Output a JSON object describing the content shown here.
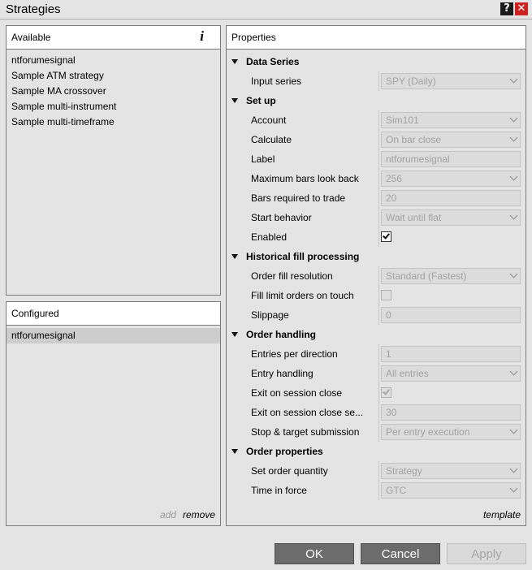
{
  "window": {
    "title": "Strategies",
    "help_glyph": "?",
    "close_glyph": "✕"
  },
  "available": {
    "header": "Available",
    "info_glyph": "i",
    "items": [
      "ntforumesignal",
      "Sample ATM strategy",
      "Sample MA crossover",
      "Sample multi-instrument",
      "Sample multi-timeframe"
    ]
  },
  "configured": {
    "header": "Configured",
    "items": [
      "ntforumesignal"
    ],
    "add_label": "add",
    "remove_label": "remove"
  },
  "properties": {
    "header": "Properties",
    "template_label": "template",
    "sections": {
      "data_series": {
        "label": "Data Series",
        "input_series_label": "Input series",
        "input_series_value": "SPY (Daily)"
      },
      "setup": {
        "label": "Set up",
        "account_label": "Account",
        "account_value": "Sim101",
        "calculate_label": "Calculate",
        "calculate_value": "On bar close",
        "label_label": "Label",
        "label_value": "ntforumesignal",
        "max_bars_label": "Maximum bars look back",
        "max_bars_value": "256",
        "bars_required_label": "Bars required to trade",
        "bars_required_value": "20",
        "start_behavior_label": "Start behavior",
        "start_behavior_value": "Wait until flat",
        "enabled_label": "Enabled",
        "enabled_value": true
      },
      "historical": {
        "label": "Historical fill processing",
        "order_fill_label": "Order fill resolution",
        "order_fill_value": "Standard (Fastest)",
        "fill_limit_label": "Fill limit orders on touch",
        "fill_limit_value": false,
        "slippage_label": "Slippage",
        "slippage_value": "0"
      },
      "order_handling": {
        "label": "Order handling",
        "entries_label": "Entries per direction",
        "entries_value": "1",
        "entry_handling_label": "Entry handling",
        "entry_handling_value": "All entries",
        "exit_session_label": "Exit on session close",
        "exit_session_value": true,
        "exit_seconds_label": "Exit on session close se...",
        "exit_seconds_value": "30",
        "stop_target_label": "Stop & target submission",
        "stop_target_value": "Per entry execution"
      },
      "order_properties": {
        "label": "Order properties",
        "quantity_label": "Set order quantity",
        "quantity_value": "Strategy",
        "tif_label": "Time in force",
        "tif_value": "GTC"
      }
    }
  },
  "buttons": {
    "ok": "OK",
    "cancel": "Cancel",
    "apply": "Apply"
  }
}
